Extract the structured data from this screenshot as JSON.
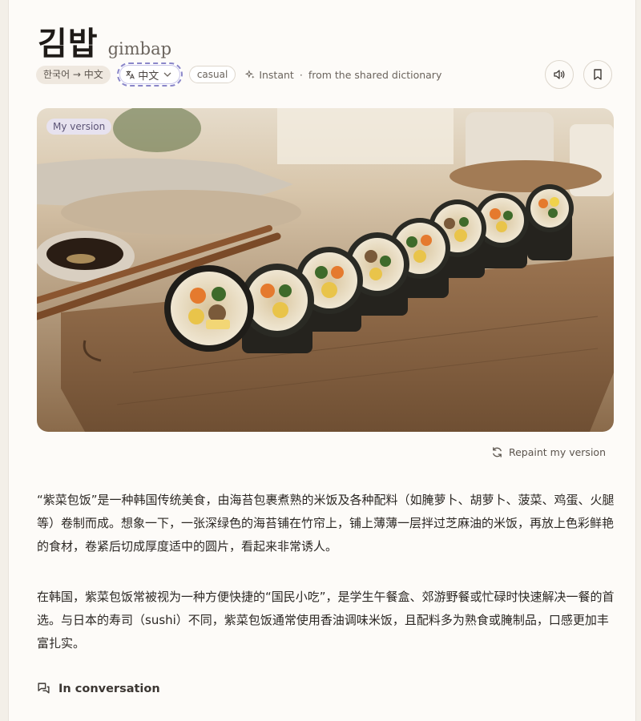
{
  "entry": {
    "word": "김밥",
    "romanization": "gimbap"
  },
  "chips": {
    "direction": "한국어 → 中文",
    "target_language": "中文",
    "register": "casual",
    "source_mode": "Instant",
    "source_separator": "·",
    "source": "from the shared dictionary"
  },
  "actions": {
    "audio_icon": "speaker-icon",
    "bookmark_icon": "bookmark-icon",
    "repaint_label": "Repaint my version"
  },
  "image": {
    "badge": "My version"
  },
  "body": {
    "paragraph_1": "“紫菜包饭”是一种韩国传统美食，由海苔包裹煮熟的米饭及各种配料（如腌萝卜、胡萝卜、菠菜、鸡蛋、火腿等）卷制而成。想象一下，一张深绿色的海苔铺在竹帘上，铺上薄薄一层拌过芝麻油的米饭，再放上色彩鲜艳的食材，卷紧后切成厚度适中的圆片，看起来非常诱人。",
    "paragraph_2": "在韩国，紫菜包饭常被视为一种方便快捷的“国民小吃”，是学生午餐盒、郊游野餐或忙碌时快速解决一餐的首选。与日本的寿司（sushi）不同，紫菜包饭通常使用香油调味米饭，且配料多为熟食或腌制品，口感更加丰富扎实。"
  },
  "section": {
    "in_conversation": "In conversation"
  },
  "colors": {
    "accent_focus": "#8a86c9",
    "badge_bg": "#e7e2ef",
    "page_bg": "#fdfbf8"
  }
}
